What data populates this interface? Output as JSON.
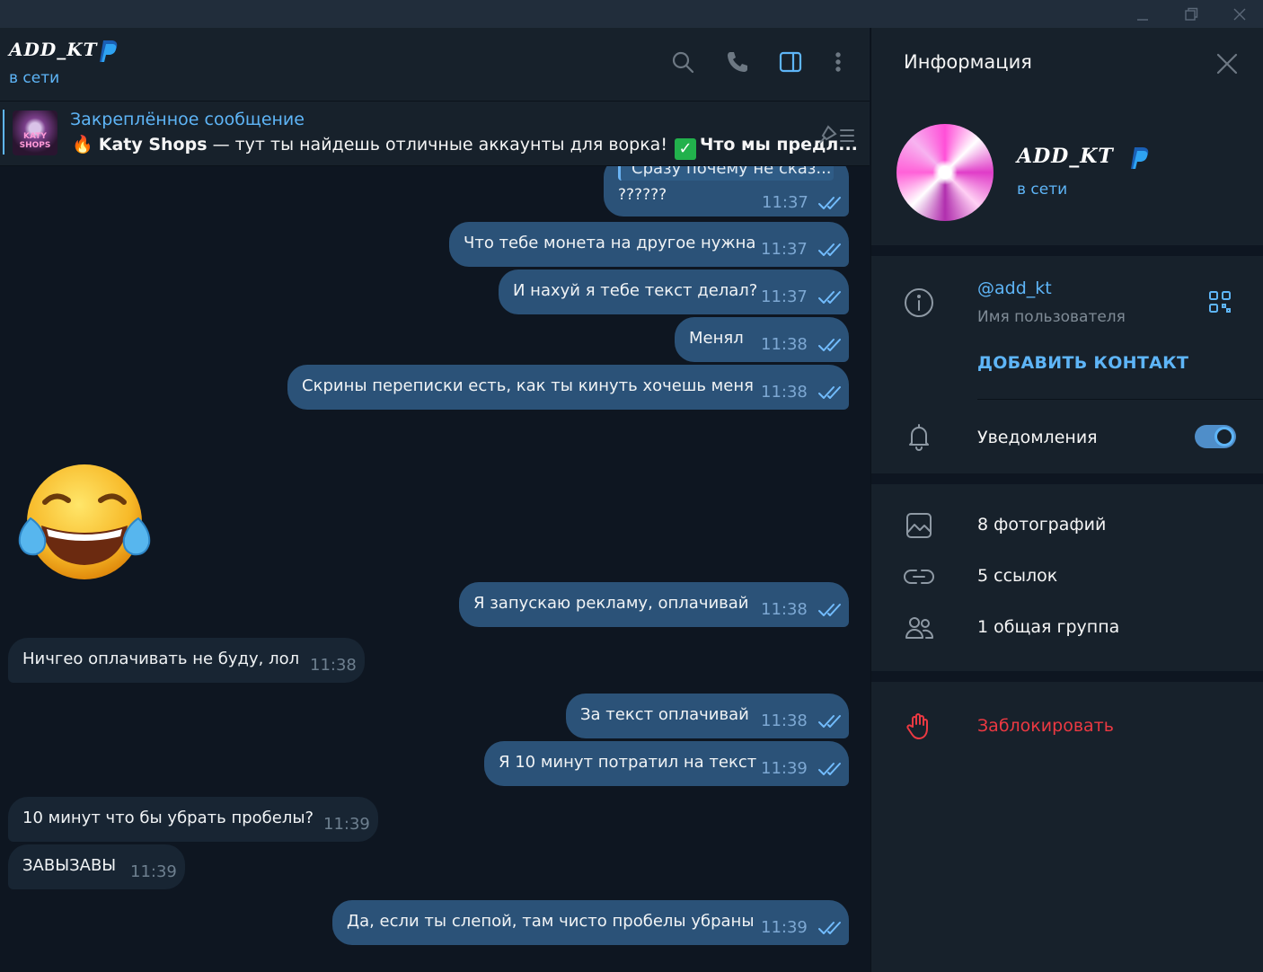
{
  "window": {
    "controls": [
      "minimize",
      "restore",
      "close"
    ]
  },
  "chat": {
    "peer_name": "ADD_KT",
    "peer_status": "в сети",
    "header_icons": [
      "search-icon",
      "phone-icon",
      "sidebar-toggle-icon",
      "more-vert-icon"
    ],
    "pinned": {
      "title": "Закреплённое сообщение",
      "thumb_label": "KATY SHOPS",
      "emoji": "🔥",
      "bold_prefix": "Katy Shops",
      "text": " — тут ты найдешь отличные аккаунты для ворка! ",
      "check": "✓",
      "bold_suffix": "Что мы предл..."
    },
    "messages": [
      {
        "dir": "out",
        "quote": "Сразу почему не сказ...",
        "text": "??????",
        "time": "11:37"
      },
      {
        "dir": "out",
        "text": "Что тебе монета на другое нужна",
        "time": "11:37"
      },
      {
        "dir": "out",
        "text": "И нахуй я тебе текст делал?",
        "time": "11:37"
      },
      {
        "dir": "out",
        "text": "Менял",
        "time": "11:38"
      },
      {
        "dir": "out",
        "text": "Скрины переписки есть, как ты кинуть хочешь меня",
        "time": "11:38"
      },
      {
        "dir": "in",
        "sticker": "laughing-crying-emoji"
      },
      {
        "dir": "out",
        "text": "Я запускаю рекламу, оплачивай",
        "time": "11:38"
      },
      {
        "dir": "in",
        "text": "Ничгео оплачивать не буду, лол",
        "time": "11:38"
      },
      {
        "dir": "out",
        "text": "За текст оплачивай",
        "time": "11:38"
      },
      {
        "dir": "out",
        "text": "Я 10 минут потратил на текст",
        "time": "11:39"
      },
      {
        "dir": "in",
        "text": "10 минут что бы убрать пробелы?",
        "time": "11:39"
      },
      {
        "dir": "in",
        "text": "ЗАВЫЗАВЫ",
        "time": "11:39"
      },
      {
        "dir": "out",
        "text": "Да, если ты слепой, там чисто пробелы убраны",
        "time": "11:39"
      }
    ]
  },
  "info_panel": {
    "title": "Информация",
    "name": "ADD_KT",
    "status": "в сети",
    "username": "@add_kt",
    "username_label": "Имя пользователя",
    "add_contact": "ДОБАВИТЬ КОНТАКТ",
    "notifications_label": "Уведомления",
    "notifications_on": true,
    "media": {
      "photos": "8 фотографий",
      "links": "5 ссылок",
      "groups": "1 общая группа"
    },
    "block": "Заблокировать"
  },
  "colors": {
    "accent": "#5eb5f7",
    "outgoing_bubble": "#2b5278",
    "incoming_bubble": "#182533",
    "background": "#0e1621",
    "panel": "#17212b",
    "danger": "#ec3942"
  }
}
